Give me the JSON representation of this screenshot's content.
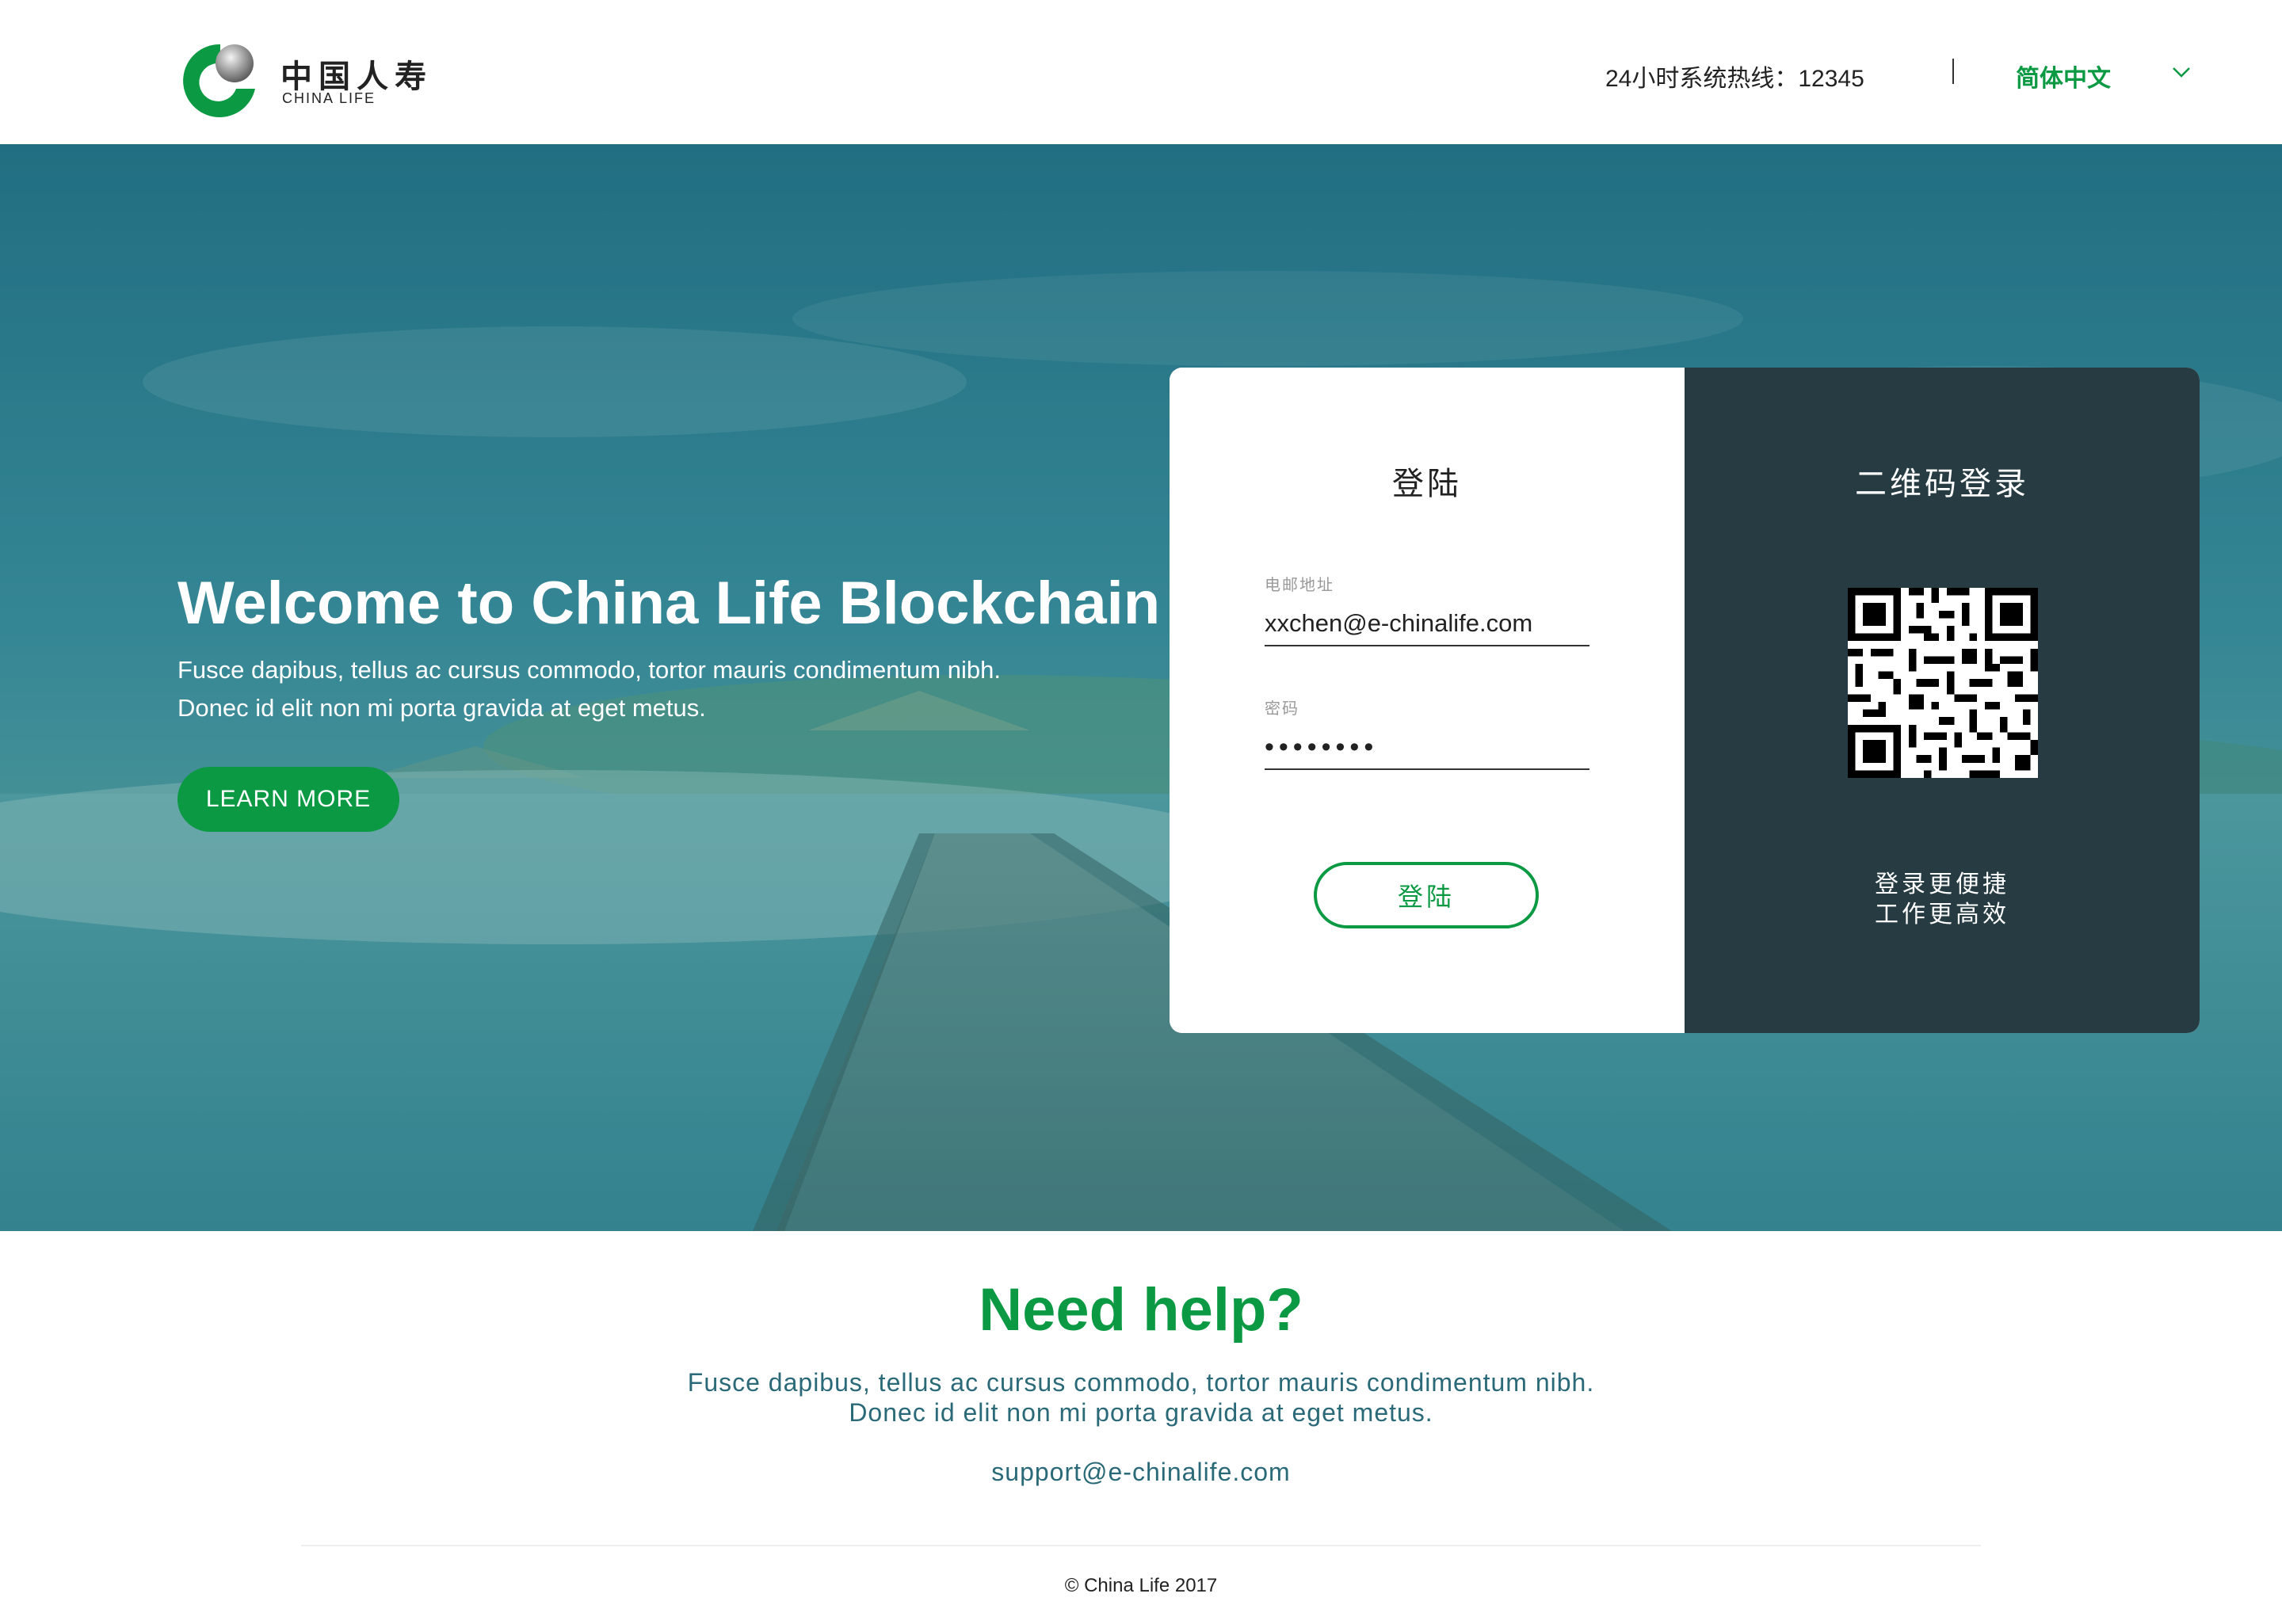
{
  "header": {
    "logo": {
      "name_cn": "中国人寿",
      "name_en": "CHINA LIFE",
      "icon": "china-life-logo-icon"
    },
    "hotline": "24小时系统热线：12345",
    "language": {
      "selected": "简体中文",
      "icon": "chevron-down-icon"
    }
  },
  "hero": {
    "title": "Welcome to China Life Blockchain",
    "subtitle_lines": [
      "Fusce dapibus, tellus ac cursus commodo, tortor mauris condimentum nibh.",
      "Donec id elit non mi porta gravida at eget metus."
    ],
    "cta": "LEARN MORE"
  },
  "login": {
    "title": "登陆",
    "email": {
      "label": "电邮地址",
      "value": "xxchen@e-chinalife.com"
    },
    "password": {
      "label": "密码",
      "value": "••••••••"
    },
    "submit": "登陆"
  },
  "qr_login": {
    "title": "二维码登录",
    "caption_lines": [
      "登录更便捷",
      "工作更高效"
    ]
  },
  "help": {
    "title": "Need help?",
    "lines": [
      "Fusce dapibus, tellus ac cursus commodo, tortor mauris condimentum nibh.",
      "Donec id elit non mi porta gravida at eget metus."
    ],
    "email": "support@e-chinalife.com"
  },
  "footer": {
    "copyright": "© China Life 2017"
  },
  "colors": {
    "brand_green": "#0b9a43",
    "qr_panel": "#263c42",
    "hero_teal": "#2a7a88",
    "help_text": "#2a6a78"
  }
}
